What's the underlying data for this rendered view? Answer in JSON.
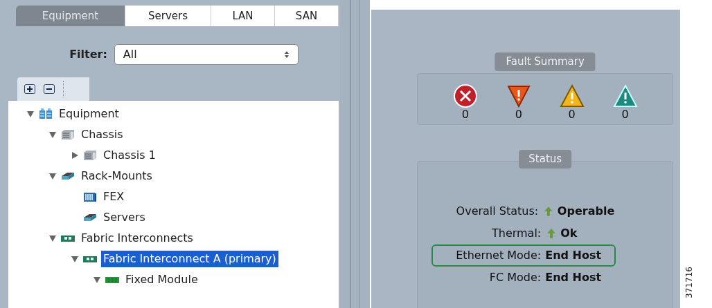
{
  "tabs": [
    {
      "label": "Equipment",
      "selected": true
    },
    {
      "label": "Servers",
      "selected": false
    },
    {
      "label": "LAN",
      "selected": false
    },
    {
      "label": "SAN",
      "selected": false
    }
  ],
  "filter": {
    "label": "Filter:",
    "value": "All"
  },
  "toolbar": [
    {
      "kind": "expand"
    },
    {
      "kind": "collapse"
    }
  ],
  "tree": [
    {
      "label": "Equipment",
      "kind": "equipment",
      "expanded": true,
      "selected": false,
      "children": [
        {
          "label": "Chassis",
          "kind": "chassis",
          "expanded": true,
          "selected": false,
          "children": [
            {
              "label": "Chassis 1",
              "kind": "chassis",
              "expanded": false,
              "selected": false
            }
          ]
        },
        {
          "label": "Rack-Mounts",
          "kind": "rack",
          "expanded": true,
          "selected": false,
          "children": [
            {
              "label": "FEX",
              "kind": "fex",
              "selected": false
            },
            {
              "label": "Servers",
              "kind": "rack",
              "selected": false
            }
          ]
        },
        {
          "label": "Fabric Interconnects",
          "kind": "fabric",
          "expanded": true,
          "selected": false,
          "children": [
            {
              "label": "Fabric Interconnect A (primary)",
              "kind": "fabric",
              "expanded": true,
              "selected": true,
              "children": [
                {
                  "label": "Fixed Module",
                  "kind": "module",
                  "expanded": true,
                  "selected": false
                }
              ]
            }
          ]
        }
      ]
    }
  ],
  "fault_summary": {
    "title": "Fault Summary",
    "faults": [
      {
        "kind": "critical",
        "count": "0"
      },
      {
        "kind": "major",
        "count": "0"
      },
      {
        "kind": "minor",
        "count": "0"
      },
      {
        "kind": "warning",
        "count": "0"
      }
    ]
  },
  "status": {
    "title": "Status",
    "rows": [
      {
        "label": "Overall Status:",
        "value": "Operable",
        "kind": "up",
        "highlighted": false
      },
      {
        "label": "Thermal:",
        "value": "Ok",
        "kind": "up",
        "highlighted": false
      },
      {
        "label": "Ethernet Mode:",
        "value": "End Host",
        "kind": "plain",
        "highlighted": true
      },
      {
        "label": "FC Mode:",
        "value": "End Host",
        "kind": "plain",
        "highlighted": false
      }
    ]
  },
  "figure_number": "371716"
}
